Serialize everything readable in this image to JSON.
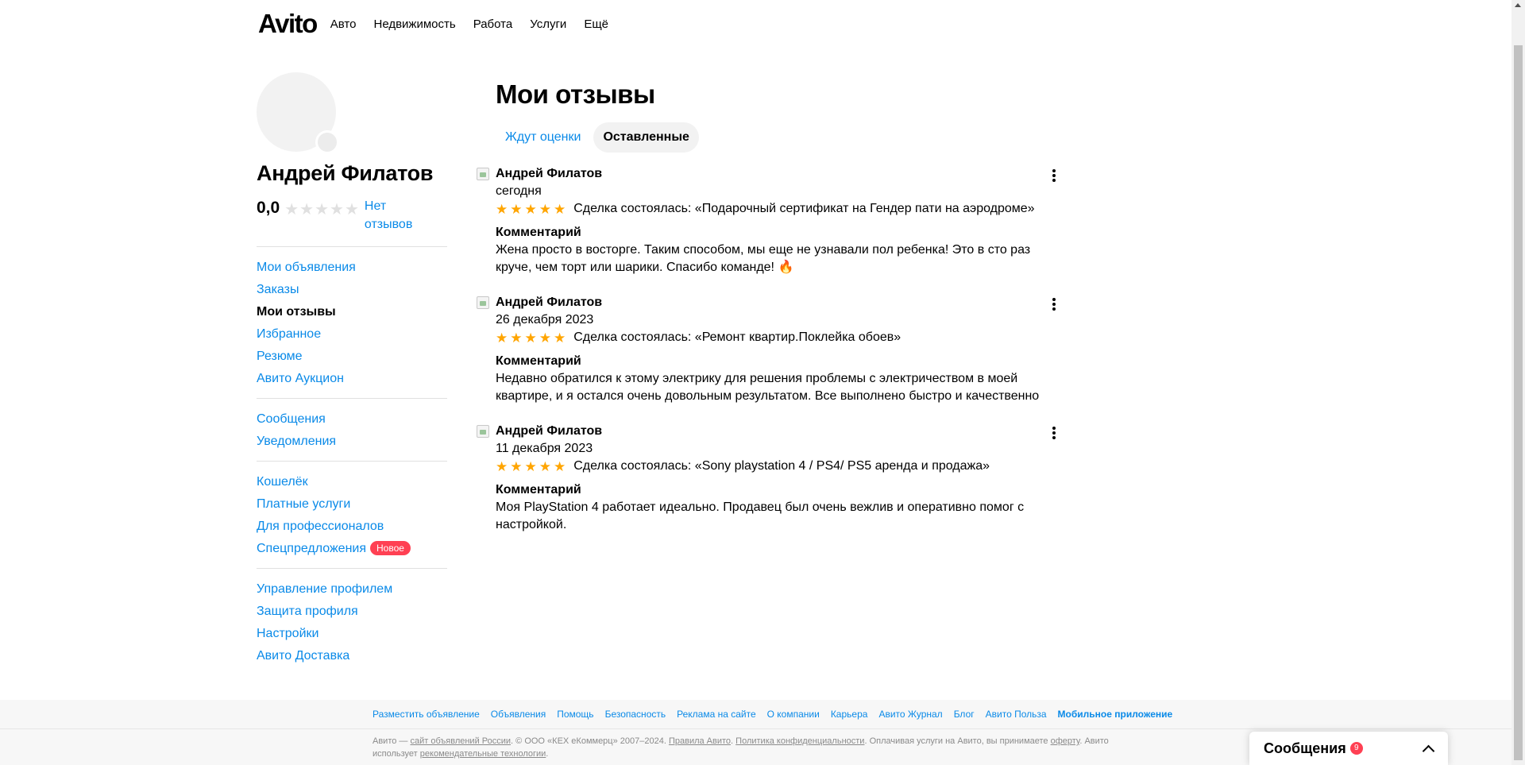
{
  "header": {
    "logo": "Avito",
    "nav": [
      "Авто",
      "Недвижимость",
      "Работа",
      "Услуги",
      "Ещё"
    ]
  },
  "profile": {
    "name": "Андрей Филатов",
    "rating": "0,0",
    "rating_stars": 0,
    "no_reviews_label": "Нет отзывов"
  },
  "sidebar": {
    "groups": [
      [
        "Мои объявления",
        "Заказы",
        "Мои отзывы",
        "Избранное",
        "Резюме",
        "Авито Аукцион"
      ],
      [
        "Сообщения",
        "Уведомления"
      ],
      [
        "Кошелёк",
        "Платные услуги",
        "Для профессионалов",
        "Спецпредложения"
      ],
      [
        "Управление профилем",
        "Защита профиля",
        "Настройки",
        "Авито Доставка"
      ]
    ],
    "active_item": "Мои отзывы",
    "new_badge": "Новое"
  },
  "main": {
    "title": "Мои отзывы",
    "tabs": [
      "Ждут оценки",
      "Оставленные"
    ],
    "active_tab": "Оставленные",
    "comment_label": "Комментарий",
    "reviews": [
      {
        "author": "Андрей Филатов",
        "date": "сегодня",
        "stars": 5,
        "deal": "Сделка состоялась: «Подарочный сертификат на Гендер пати на аэродроме»",
        "comment": "Жена просто в восторге. Таким способом, мы еще не узнавали пол ребенка! Это в сто раз круче, чем торт или шарики. Спасибо команде! 🔥"
      },
      {
        "author": "Андрей Филатов",
        "date": "26 декабря 2023",
        "stars": 5,
        "deal": "Сделка состоялась: «Ремонт квартир.Поклейка обоев»",
        "comment": "Недавно обратился к этому электрику для решения проблемы с электричеством в моей квартире, и я остался очень довольным результатом. Все выполнено быстро и качественно"
      },
      {
        "author": "Андрей Филатов",
        "date": "11 декабря 2023",
        "stars": 5,
        "deal": "Сделка состоялась: «Sony playstation 4 / PS4/ PS5 аренда и продажа»",
        "comment": "Моя PlayStation 4 работает идеально. Продавец был очень вежлив и оперативно помог с настройкой."
      }
    ]
  },
  "footer": {
    "links": [
      "Разместить объявление",
      "Объявления",
      "Помощь",
      "Безопасность",
      "Реклама на сайте",
      "О компании",
      "Карьера",
      "Авито Журнал",
      "Блог",
      "Авито Польза",
      "Мобильное приложение"
    ],
    "legal": {
      "t1": "Авито — ",
      "l1": "сайт объявлений России",
      "t2": ". © ООО «КЕХ еКоммерц» 2007–2024. ",
      "l2": "Правила Авито",
      "t3": ". ",
      "l3": "Политика конфиденциальности",
      "t4": ". Оплачивая услуги на Авито, вы принимаете ",
      "l4": "оферту",
      "t5": ". Авито использует ",
      "l5": "рекомендательные технологии",
      "t6": "."
    }
  },
  "messenger": {
    "label": "Сообщения",
    "count": "9"
  },
  "colors": {
    "link": "#0a8ae8",
    "star_active": "#ffa500",
    "star_inactive": "#e0e0e0",
    "badge": "#ff4053"
  }
}
